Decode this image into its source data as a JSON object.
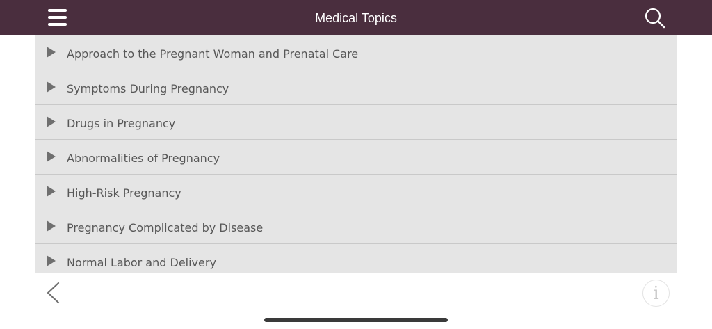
{
  "header": {
    "title": "Medical Topics",
    "menu_icon": "hamburger-menu-icon",
    "search_icon": "search-icon"
  },
  "topics": [
    {
      "label": "Approach to the Pregnant Woman and Prenatal Care",
      "icon": "expand-arrow-icon"
    },
    {
      "label": "Symptoms During Pregnancy",
      "icon": "expand-arrow-icon"
    },
    {
      "label": "Drugs in Pregnancy",
      "icon": "expand-arrow-icon"
    },
    {
      "label": "Abnormalities of Pregnancy",
      "icon": "expand-arrow-icon"
    },
    {
      "label": "High-Risk Pregnancy",
      "icon": "expand-arrow-icon"
    },
    {
      "label": "Pregnancy Complicated by Disease",
      "icon": "expand-arrow-icon"
    },
    {
      "label": "Normal Labor and Delivery",
      "icon": "expand-arrow-icon"
    }
  ],
  "footer": {
    "back_icon": "chevron-left-icon",
    "info_label": "i",
    "info_icon": "info-icon"
  },
  "colors": {
    "header_bg": "#4a2e3e",
    "row_bg": "#e5e5e5",
    "row_divider": "#c9c9c9",
    "row_text": "#575757"
  }
}
